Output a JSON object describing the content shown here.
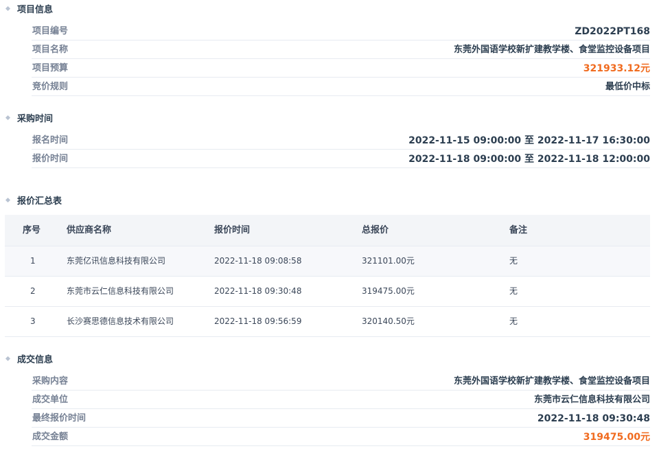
{
  "project_info": {
    "title": "项目信息",
    "rows": [
      {
        "label": "项目编号",
        "value": "ZD2022PT168"
      },
      {
        "label": "项目名称",
        "value": "东莞外国语学校新扩建教学楼、食堂监控设备项目"
      },
      {
        "label": "项目预算",
        "value": "321933.12元"
      },
      {
        "label": "竞价规则",
        "value": "最低价中标"
      }
    ]
  },
  "procurement_time": {
    "title": "采购时间",
    "rows": [
      {
        "label": "报名时间",
        "start": "2022-11-15 09:00:00",
        "sep": "至",
        "end": "2022-11-17 16:30:00"
      },
      {
        "label": "报价时间",
        "start": "2022-11-18 09:00:00",
        "sep": "至",
        "end": "2022-11-18 12:00:00"
      }
    ]
  },
  "quote_summary": {
    "title": "报价汇总表",
    "headers": [
      "序号",
      "供应商名称",
      "报价时间",
      "总报价",
      "备注"
    ],
    "rows": [
      {
        "no": "1",
        "supplier": "东莞亿讯信息科技有限公司",
        "time": "2022-11-18 09:08:58",
        "price": "321101.00元",
        "note": "无"
      },
      {
        "no": "2",
        "supplier": "东莞市云仁信息科技有限公司",
        "time": "2022-11-18 09:30:48",
        "price": "319475.00元",
        "note": "无"
      },
      {
        "no": "3",
        "supplier": "长沙赛思德信息技术有限公司",
        "time": "2022-11-18 09:56:59",
        "price": "320140.50元",
        "note": "无"
      }
    ]
  },
  "deal_info": {
    "title": "成交信息",
    "rows": [
      {
        "label": "采购内容",
        "value": "东莞外国语学校新扩建教学楼、食堂监控设备项目"
      },
      {
        "label": "成交单位",
        "value": "东莞市云仁信息科技有限公司"
      },
      {
        "label": "最终报价时间",
        "value": "2022-11-18 09:30:48"
      },
      {
        "label": "成交金额",
        "value": "319475.00元"
      }
    ]
  },
  "colors": {
    "accent_price": "#f06b1f",
    "label_gray": "#768194",
    "value_dark": "#2c3e50"
  }
}
